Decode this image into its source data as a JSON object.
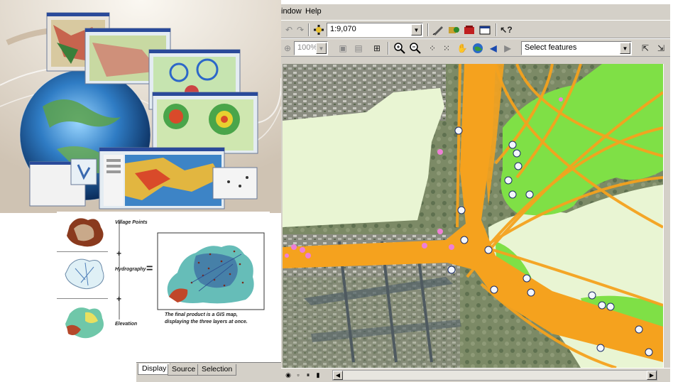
{
  "collage": {
    "description_icons": [
      "globe-icon",
      "map-window-icon"
    ]
  },
  "diagram": {
    "layer1_label": "Village Points",
    "layer2_label": "Hydrography",
    "layer3_label": "Elevation",
    "caption_line1": "The final product is a GIS map,",
    "caption_line2": "displaying the three layers at once.",
    "plus": "+",
    "equals": "="
  },
  "toc_tabs": [
    {
      "label": "Display"
    },
    {
      "label": "Source"
    },
    {
      "label": "Selection"
    }
  ],
  "menubar": {
    "window": "indow",
    "help": "Help"
  },
  "toolbar1": {
    "scale": "1:9,070"
  },
  "toolbar2": {
    "zoom": "100%",
    "tool_select": "Select features"
  },
  "colors": {
    "route": "#f5a21e",
    "land_green": "#7fe046",
    "water_pale": "#e9f5d3",
    "marker_pink": "#ee7fd6"
  }
}
